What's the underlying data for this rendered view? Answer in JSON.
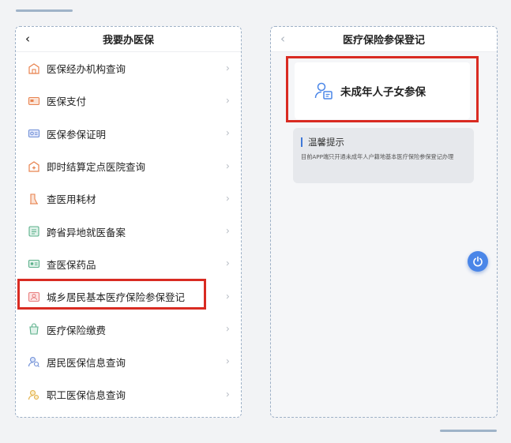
{
  "left_screen": {
    "nav_title": "我要办医保",
    "back_glyph": "‹",
    "items": [
      {
        "label": "医保经办机构查询",
        "icon": "building-icon"
      },
      {
        "label": "医保支付",
        "icon": "payment-card-icon"
      },
      {
        "label": "医保参保证明",
        "icon": "certificate-icon"
      },
      {
        "label": "即时结算定点医院查询",
        "icon": "hospital-icon"
      },
      {
        "label": "查医用耗材",
        "icon": "medical-supply-icon"
      },
      {
        "label": "跨省异地就医备案",
        "icon": "filing-icon"
      },
      {
        "label": "查医保药品",
        "icon": "medicine-icon"
      },
      {
        "label": "城乡居民基本医疗保险参保登记",
        "icon": "registration-icon"
      },
      {
        "label": "医疗保险缴费",
        "icon": "payment-icon"
      },
      {
        "label": "居民医保信息查询",
        "icon": "resident-info-icon"
      },
      {
        "label": "职工医保信息查询",
        "icon": "employee-info-icon"
      }
    ],
    "chevron_glyph": "›"
  },
  "right_screen": {
    "nav_title": "医疗保险参保登记",
    "back_glyph": "‹",
    "main_card_label": "未成年人子女参保",
    "tip_title": "温馨提示",
    "tip_body": "目前APP端只开通未成年人户籍地基本医疗保险参保登记办理"
  },
  "colors": {
    "highlight": "#d92b22",
    "accent": "#4a86e8",
    "icon_orange": "#e8834f",
    "icon_green": "#5bb08a",
    "icon_blue": "#6f8fd6"
  }
}
